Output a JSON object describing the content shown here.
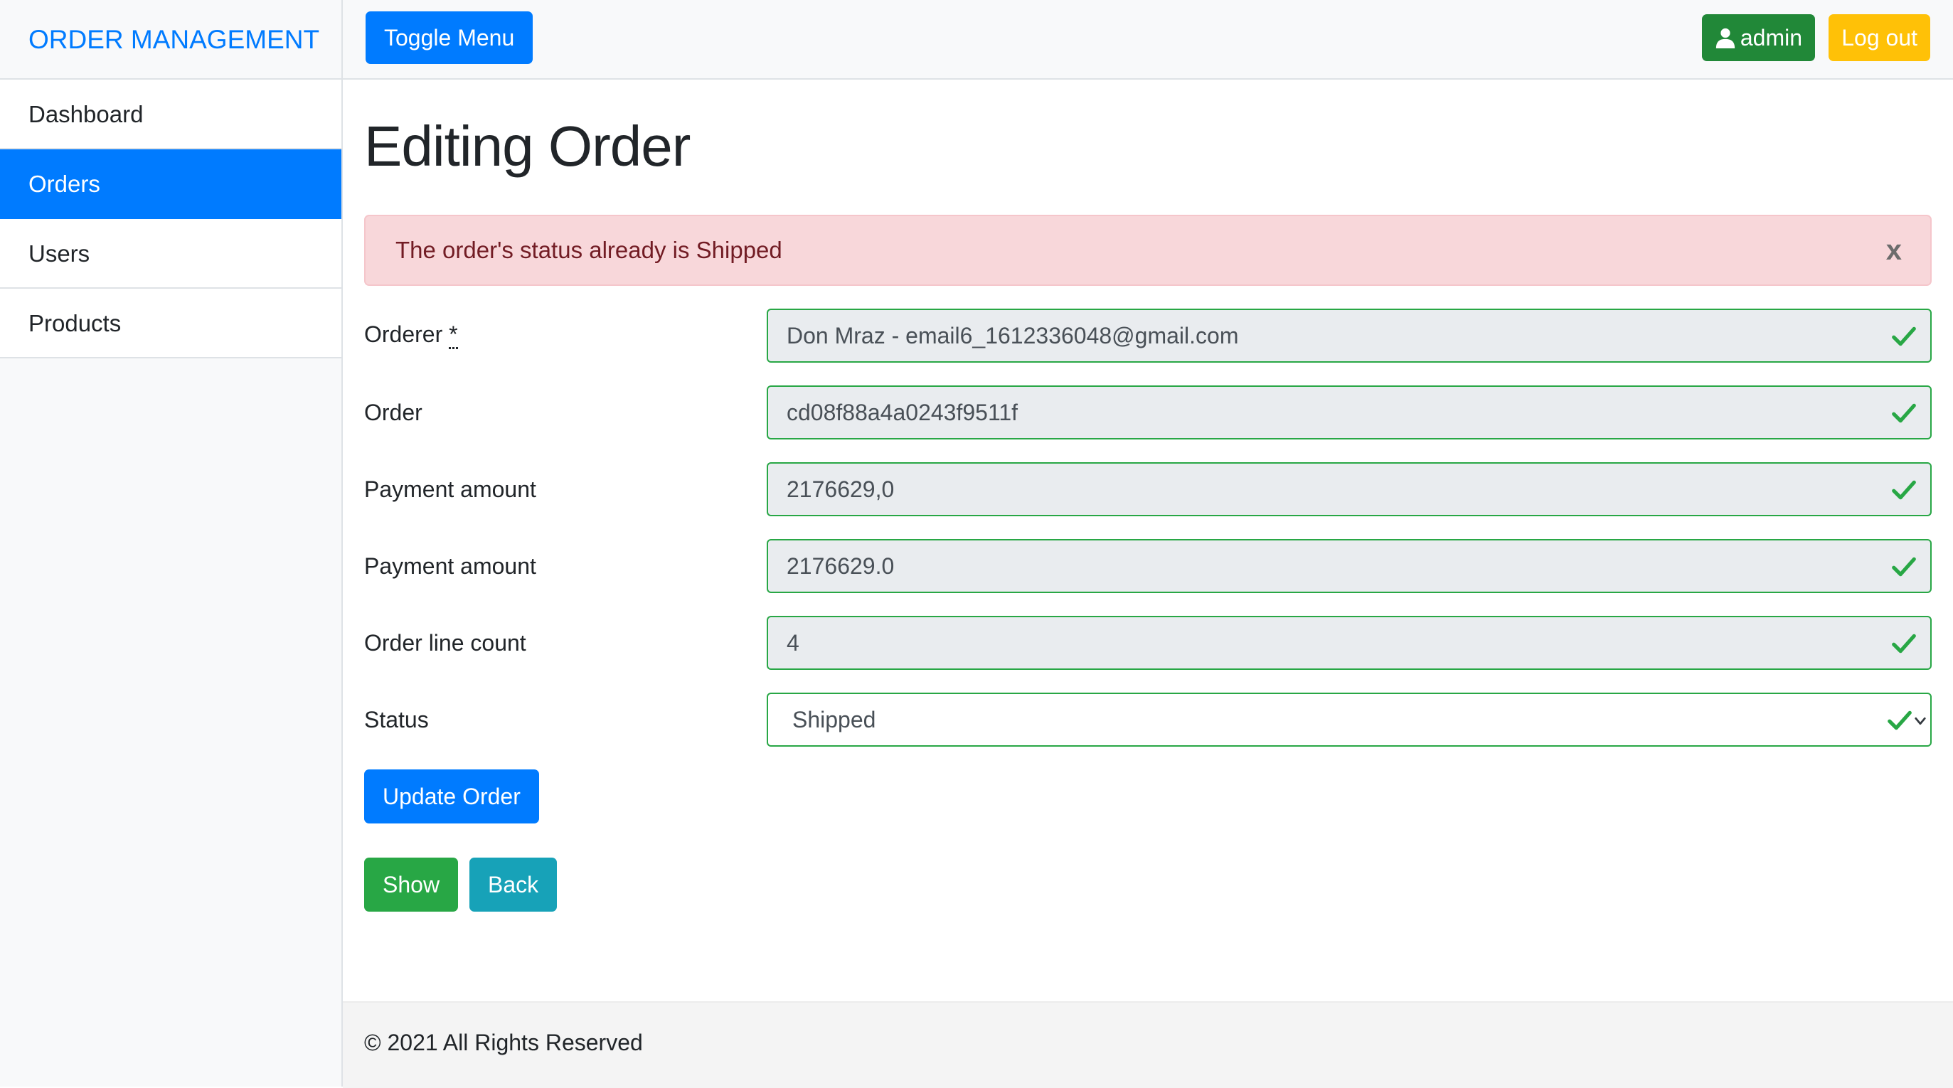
{
  "sidebar": {
    "brand": "ORDER MANAGEMENT",
    "items": [
      {
        "label": "Dashboard"
      },
      {
        "label": "Orders"
      },
      {
        "label": "Users"
      },
      {
        "label": "Products"
      }
    ],
    "active_item": "Orders"
  },
  "topbar": {
    "toggle_label": "Toggle Menu",
    "user_label": "admin",
    "user_icon": "user-icon",
    "logout_label": "Log out"
  },
  "page": {
    "title": "Editing Order",
    "alert_message": "The order's status already is Shipped",
    "alert_close": "x"
  },
  "form": {
    "orderer": {
      "label": "Orderer",
      "required_mark": "*",
      "value": "Don Mraz - email6_1612336048@gmail.com"
    },
    "order": {
      "label": "Order",
      "value": "cd08f88a4a0243f9511f"
    },
    "payment_amount_1": {
      "label": "Payment amount",
      "value": "2176629,0"
    },
    "payment_amount_2": {
      "label": "Payment amount",
      "value": "2176629.0"
    },
    "order_line_count": {
      "label": "Order line count",
      "value": "4"
    },
    "status": {
      "label": "Status",
      "value": "Shipped"
    },
    "valid_icon": "check-icon"
  },
  "actions": {
    "update_label": "Update Order",
    "show_label": "Show",
    "back_label": "Back"
  },
  "footer": {
    "text": "© 2021 All Rights Reserved"
  },
  "colors": {
    "primary": "#007bff",
    "success": "#28a745",
    "warning": "#ffc107",
    "info": "#17a2b8",
    "alert_bg": "#f8d7da",
    "alert_text": "#721c24"
  }
}
